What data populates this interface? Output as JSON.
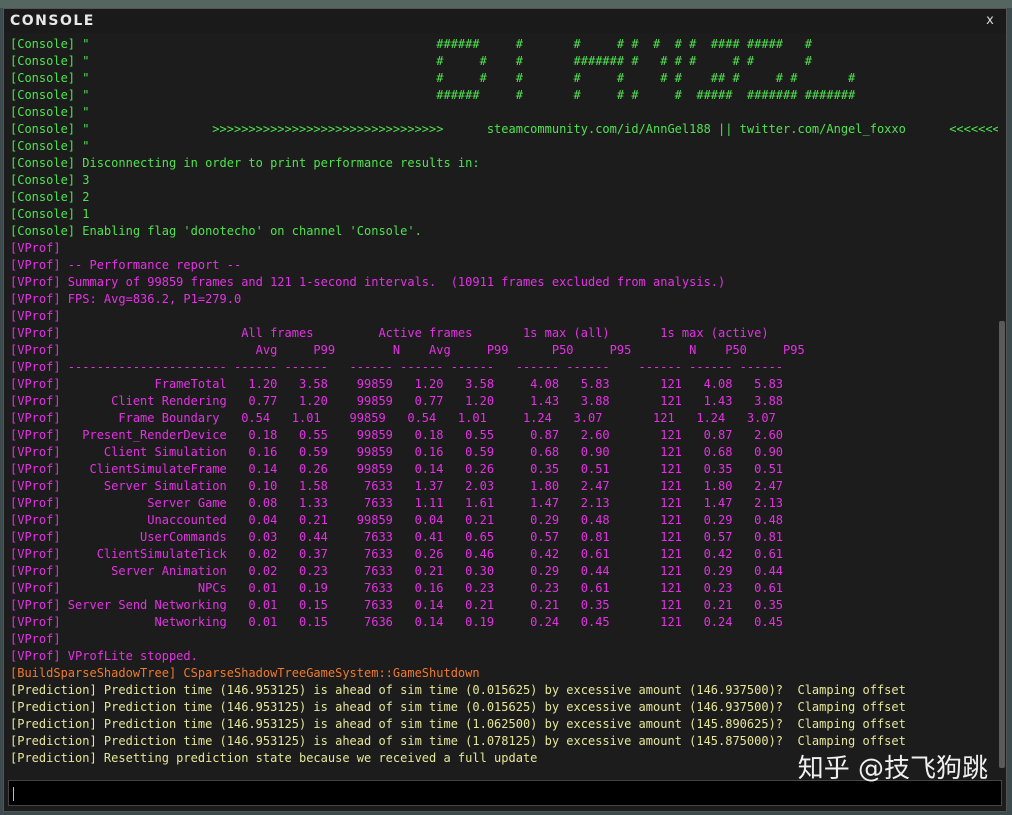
{
  "window": {
    "title": "CONSOLE",
    "close_label": "x"
  },
  "lines": [
    {
      "text": "[Console] \"                                                ######     #       #     # #  #  # #  #### #####   #",
      "color": "green"
    },
    {
      "text": "[Console] \"                                                #     #    #       ####### #   # # #     # #       #",
      "color": "green"
    },
    {
      "text": "[Console] \"                                                #     #    #       #     #     # #    ## #     # #       #",
      "color": "green"
    },
    {
      "text": "[Console] \"                                                ######     #       #     # #     #  #####  ####### #######",
      "color": "green"
    },
    {
      "text": "[Console] \"",
      "color": "green"
    },
    {
      "text": "[Console] \"                 >>>>>>>>>>>>>>>>>>>>>>>>>>>>>>>>      steamcommunity.com/id/AnnGel188 || twitter.com/Angel_foxxo      <<<<<<<<<<<<",
      "color": "green"
    },
    {
      "text": "[Console] \"",
      "color": "green"
    },
    {
      "text": "[Console] Disconnecting in order to print performance results in:",
      "color": "green"
    },
    {
      "text": "[Console] 3",
      "color": "green"
    },
    {
      "text": "[Console] 2",
      "color": "green"
    },
    {
      "text": "[Console] 1",
      "color": "green"
    },
    {
      "text": "[Console] Enabling flag 'donotecho' on channel 'Console'.",
      "color": "green"
    },
    {
      "text": "[VProf]",
      "color": "magenta"
    },
    {
      "text": "[VProf] -- Performance report --",
      "color": "magenta"
    },
    {
      "text": "[VProf] Summary of 99859 frames and 121 1-second intervals.  (10911 frames excluded from analysis.)",
      "color": "magenta"
    },
    {
      "text": "[VProf] FPS: Avg=836.2, P1=279.0",
      "color": "magenta"
    },
    {
      "text": "[VProf]",
      "color": "magenta"
    },
    {
      "text": "[VProf]                         All frames         Active frames       1s max (all)       1s max (active)",
      "color": "magenta"
    },
    {
      "text": "[VProf]                           Avg     P99        N    Avg     P99      P50     P95        N    P50     P95",
      "color": "magenta"
    },
    {
      "text": "[VProf] ---------------------- ------ ------   ------ ------ ------   ------ ------    ------ ------ ------",
      "color": "magenta"
    },
    {
      "text": "[VProf]             FrameTotal   1.20   3.58    99859   1.20   3.58     4.08   5.83       121   4.08   5.83",
      "color": "magenta"
    },
    {
      "text": "[VProf]       Client Rendering   0.77   1.20    99859   0.77   1.20     1.43   3.88       121   1.43   3.88",
      "color": "magenta"
    },
    {
      "text": "[VProf]        Frame Boundary   0.54   1.01    99859   0.54   1.01     1.24   3.07       121   1.24   3.07",
      "color": "magenta"
    },
    {
      "text": "[VProf]   Present_RenderDevice   0.18   0.55    99859   0.18   0.55     0.87   2.60       121   0.87   2.60",
      "color": "magenta"
    },
    {
      "text": "[VProf]      Client Simulation   0.16   0.59    99859   0.16   0.59     0.68   0.90       121   0.68   0.90",
      "color": "magenta"
    },
    {
      "text": "[VProf]    ClientSimulateFrame   0.14   0.26    99859   0.14   0.26     0.35   0.51       121   0.35   0.51",
      "color": "magenta"
    },
    {
      "text": "[VProf]      Server Simulation   0.10   1.58     7633   1.37   2.03     1.80   2.47       121   1.80   2.47",
      "color": "magenta"
    },
    {
      "text": "[VProf]            Server Game   0.08   1.33     7633   1.11   1.61     1.47   2.13       121   1.47   2.13",
      "color": "magenta"
    },
    {
      "text": "[VProf]            Unaccounted   0.04   0.21    99859   0.04   0.21     0.29   0.48       121   0.29   0.48",
      "color": "magenta"
    },
    {
      "text": "[VProf]           UserCommands   0.03   0.44     7633   0.41   0.65     0.57   0.81       121   0.57   0.81",
      "color": "magenta"
    },
    {
      "text": "[VProf]     ClientSimulateTick   0.02   0.37     7633   0.26   0.46     0.42   0.61       121   0.42   0.61",
      "color": "magenta"
    },
    {
      "text": "[VProf]       Server Animation   0.02   0.23     7633   0.21   0.30     0.29   0.44       121   0.29   0.44",
      "color": "magenta"
    },
    {
      "text": "[VProf]                   NPCs   0.01   0.19     7633   0.16   0.23     0.23   0.61       121   0.23   0.61",
      "color": "magenta"
    },
    {
      "text": "[VProf] Server Send Networking   0.01   0.15     7633   0.14   0.21     0.21   0.35       121   0.21   0.35",
      "color": "magenta"
    },
    {
      "text": "[VProf]             Networking   0.01   0.15     7636   0.14   0.19     0.24   0.45       121   0.24   0.45",
      "color": "magenta"
    },
    {
      "text": "[VProf]",
      "color": "magenta"
    },
    {
      "text": "[VProf] VProfLite stopped.",
      "color": "magenta"
    },
    {
      "text": "[BuildSparseShadowTree] CSparseShadowTreeGameSystem::GameShutdown",
      "color": "orange"
    },
    {
      "text": "[Prediction] Prediction time (146.953125) is ahead of sim time (0.015625) by excessive amount (146.937500)?  Clamping offset",
      "color": "yellow"
    },
    {
      "text": "[Prediction] Prediction time (146.953125) is ahead of sim time (0.015625) by excessive amount (146.937500)?  Clamping offset",
      "color": "yellow"
    },
    {
      "text": "[Prediction] Prediction time (146.953125) is ahead of sim time (1.062500) by excessive amount (145.890625)?  Clamping offset",
      "color": "yellow"
    },
    {
      "text": "[Prediction] Prediction time (146.953125) is ahead of sim time (1.078125) by excessive amount (145.875000)?  Clamping offset",
      "color": "yellow"
    },
    {
      "text": "[Prediction] Resetting prediction state because we received a full update",
      "color": "yellow"
    }
  ],
  "input": {
    "value": ""
  },
  "watermark": "知乎 @技飞狗跳",
  "colors": {
    "green": "#4fe34f",
    "magenta": "#e332e3",
    "orange": "#f07a2c",
    "yellow": "#e6e69a"
  }
}
